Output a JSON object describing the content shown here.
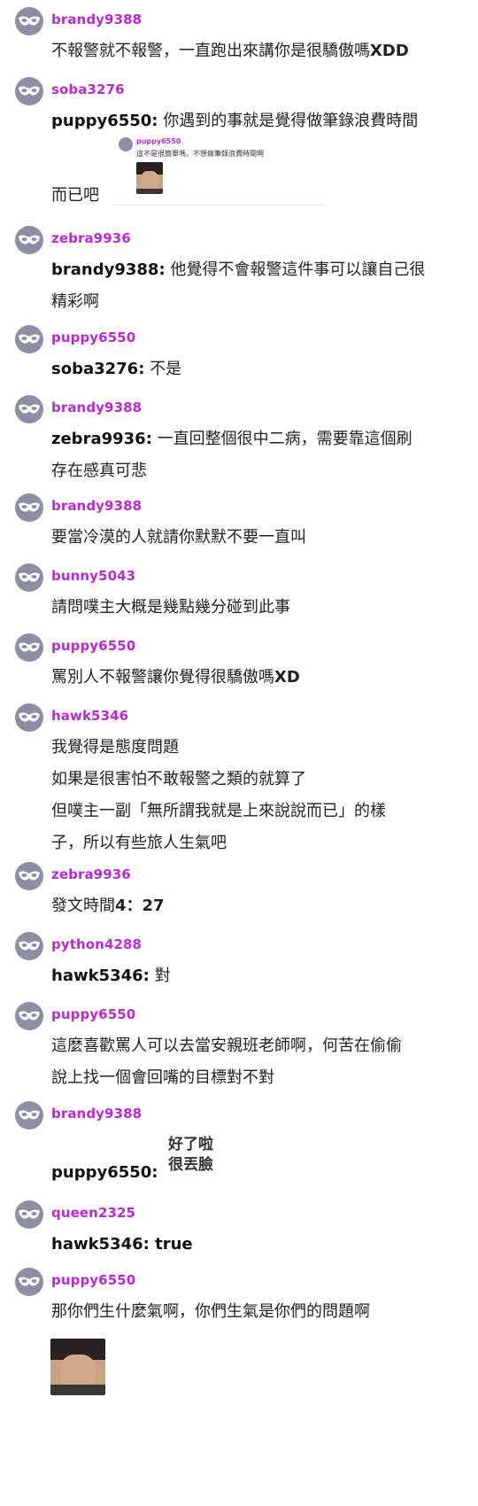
{
  "comments": [
    {
      "user": "brandy9388",
      "lines": [
        [
          {
            "t": "不報警就不報警，一直跑出來講你是很驕傲嗎",
            "s": "n"
          },
          {
            "t": "XDD",
            "s": "l"
          }
        ]
      ]
    },
    {
      "user": "soba3276",
      "lines": [
        [
          {
            "t": "puppy6550:",
            "s": "m"
          },
          {
            "t": " 你遇到的事就是覺得做筆錄浪費時間",
            "s": "n"
          }
        ],
        [
          {
            "t": "而已吧",
            "s": "n"
          }
        ]
      ],
      "embed": {
        "user": "puppy6550",
        "text": "這不是很簡單嗎，不想做筆錄浪費時間啊"
      }
    },
    {
      "user": "zebra9936",
      "lines": [
        [
          {
            "t": "brandy9388:",
            "s": "m"
          },
          {
            "t": " 他覺得不會報警這件事可以讓自己很",
            "s": "n"
          }
        ],
        [
          {
            "t": "精彩啊",
            "s": "n"
          }
        ]
      ]
    },
    {
      "user": "puppy6550",
      "lines": [
        [
          {
            "t": "soba3276:",
            "s": "m"
          },
          {
            "t": " 不是",
            "s": "n"
          }
        ]
      ]
    },
    {
      "user": "brandy9388",
      "lines": [
        [
          {
            "t": "zebra9936:",
            "s": "m"
          },
          {
            "t": " 一直回整個很中二病，需要靠這個刷",
            "s": "n"
          }
        ],
        [
          {
            "t": "存在感真可悲",
            "s": "n"
          }
        ]
      ]
    },
    {
      "user": "brandy9388",
      "lines": [
        [
          {
            "t": "要當冷漠的人就請你默默不要一直叫",
            "s": "n"
          }
        ]
      ]
    },
    {
      "user": "bunny5043",
      "lines": [
        [
          {
            "t": "請問噗主大概是幾點幾分碰到此事",
            "s": "n"
          }
        ]
      ]
    },
    {
      "user": "puppy6550",
      "lines": [
        [
          {
            "t": "罵別人不報警讓你覺得很驕傲嗎",
            "s": "n"
          },
          {
            "t": "XD",
            "s": "l"
          }
        ]
      ]
    },
    {
      "user": "hawk5346",
      "lines": [
        [
          {
            "t": "我覺得是態度問題",
            "s": "n"
          }
        ],
        [
          {
            "t": "如果是很害怕不敢報警之類的就算了",
            "s": "n"
          }
        ],
        [
          {
            "t": "但噗主一副「無所謂我就是上來說說而已」的樣",
            "s": "n"
          }
        ],
        [
          {
            "t": "子，所以有些旅人生氣吧",
            "s": "n"
          }
        ]
      ]
    },
    {
      "user": "zebra9936",
      "lines": [
        [
          {
            "t": "發文時間",
            "s": "n"
          },
          {
            "t": "4",
            "s": "l"
          },
          {
            "t": "：",
            "s": "n"
          },
          {
            "t": "27",
            "s": "l"
          }
        ]
      ]
    },
    {
      "user": "python4288",
      "lines": [
        [
          {
            "t": "hawk5346:",
            "s": "m"
          },
          {
            "t": " 對",
            "s": "n"
          }
        ]
      ]
    },
    {
      "user": "puppy6550",
      "lines": [
        [
          {
            "t": "這麼喜歡罵人可以去當安親班老師啊，何苦在偷偷",
            "s": "n"
          }
        ],
        [
          {
            "t": "說上找一個會回嘴的目標對不對",
            "s": "n"
          }
        ]
      ]
    },
    {
      "user": "brandy9388",
      "lines": [
        [
          {
            "t": "puppy6550:",
            "s": "m"
          }
        ]
      ],
      "sticker": [
        "好了啦",
        "很丟臉"
      ]
    },
    {
      "user": "queen2325",
      "lines": [
        [
          {
            "t": "hawk5346:",
            "s": "m"
          },
          {
            "t": " true",
            "s": "m"
          }
        ]
      ]
    },
    {
      "user": "puppy6550",
      "lines": [
        [
          {
            "t": "那你們生什麼氣啊，你們生氣是你們的問題啊",
            "s": "n"
          }
        ]
      ]
    }
  ]
}
